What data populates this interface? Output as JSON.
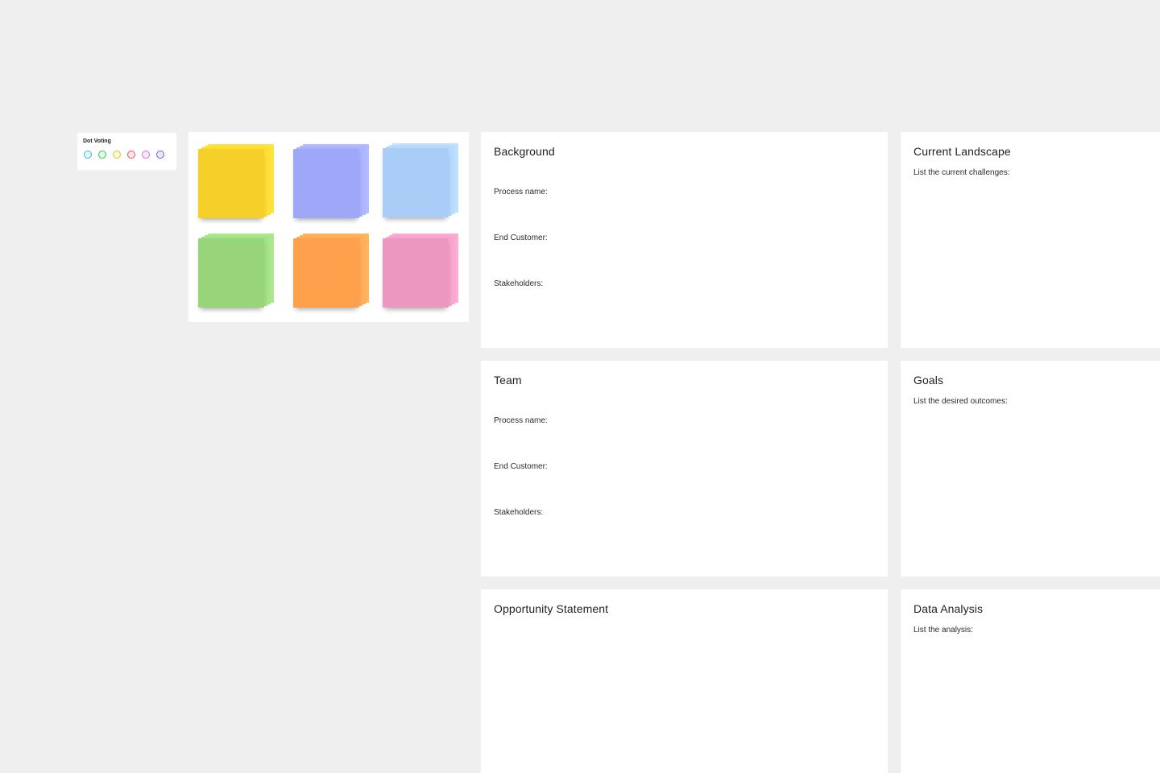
{
  "dot_voting": {
    "title": "Dot Voting",
    "dots": [
      "#35b8d6",
      "#39c457",
      "#e3c51e",
      "#ef4d64",
      "#d76ad6",
      "#6f5ce2"
    ]
  },
  "sticky_palette": {
    "colors": [
      "#f5d028",
      "#9ea7f8",
      "#a9cdf6",
      "#97d47a",
      "#fea04c",
      "#eb97bf"
    ]
  },
  "panels": {
    "background": {
      "title": "Background",
      "fields": [
        "Process name:",
        "End Customer:",
        "Stakeholders:"
      ]
    },
    "current_landscape": {
      "title": "Current Landscape",
      "hint": "List the current challenges:"
    },
    "team": {
      "title": "Team",
      "fields": [
        "Process name:",
        "End Customer:",
        "Stakeholders:"
      ]
    },
    "goals": {
      "title": "Goals",
      "hint": "List the desired outcomes:"
    },
    "opportunity": {
      "title": "Opportunity Statement"
    },
    "data_analysis": {
      "title": "Data Analysis",
      "hint": "List the analysis:"
    }
  }
}
